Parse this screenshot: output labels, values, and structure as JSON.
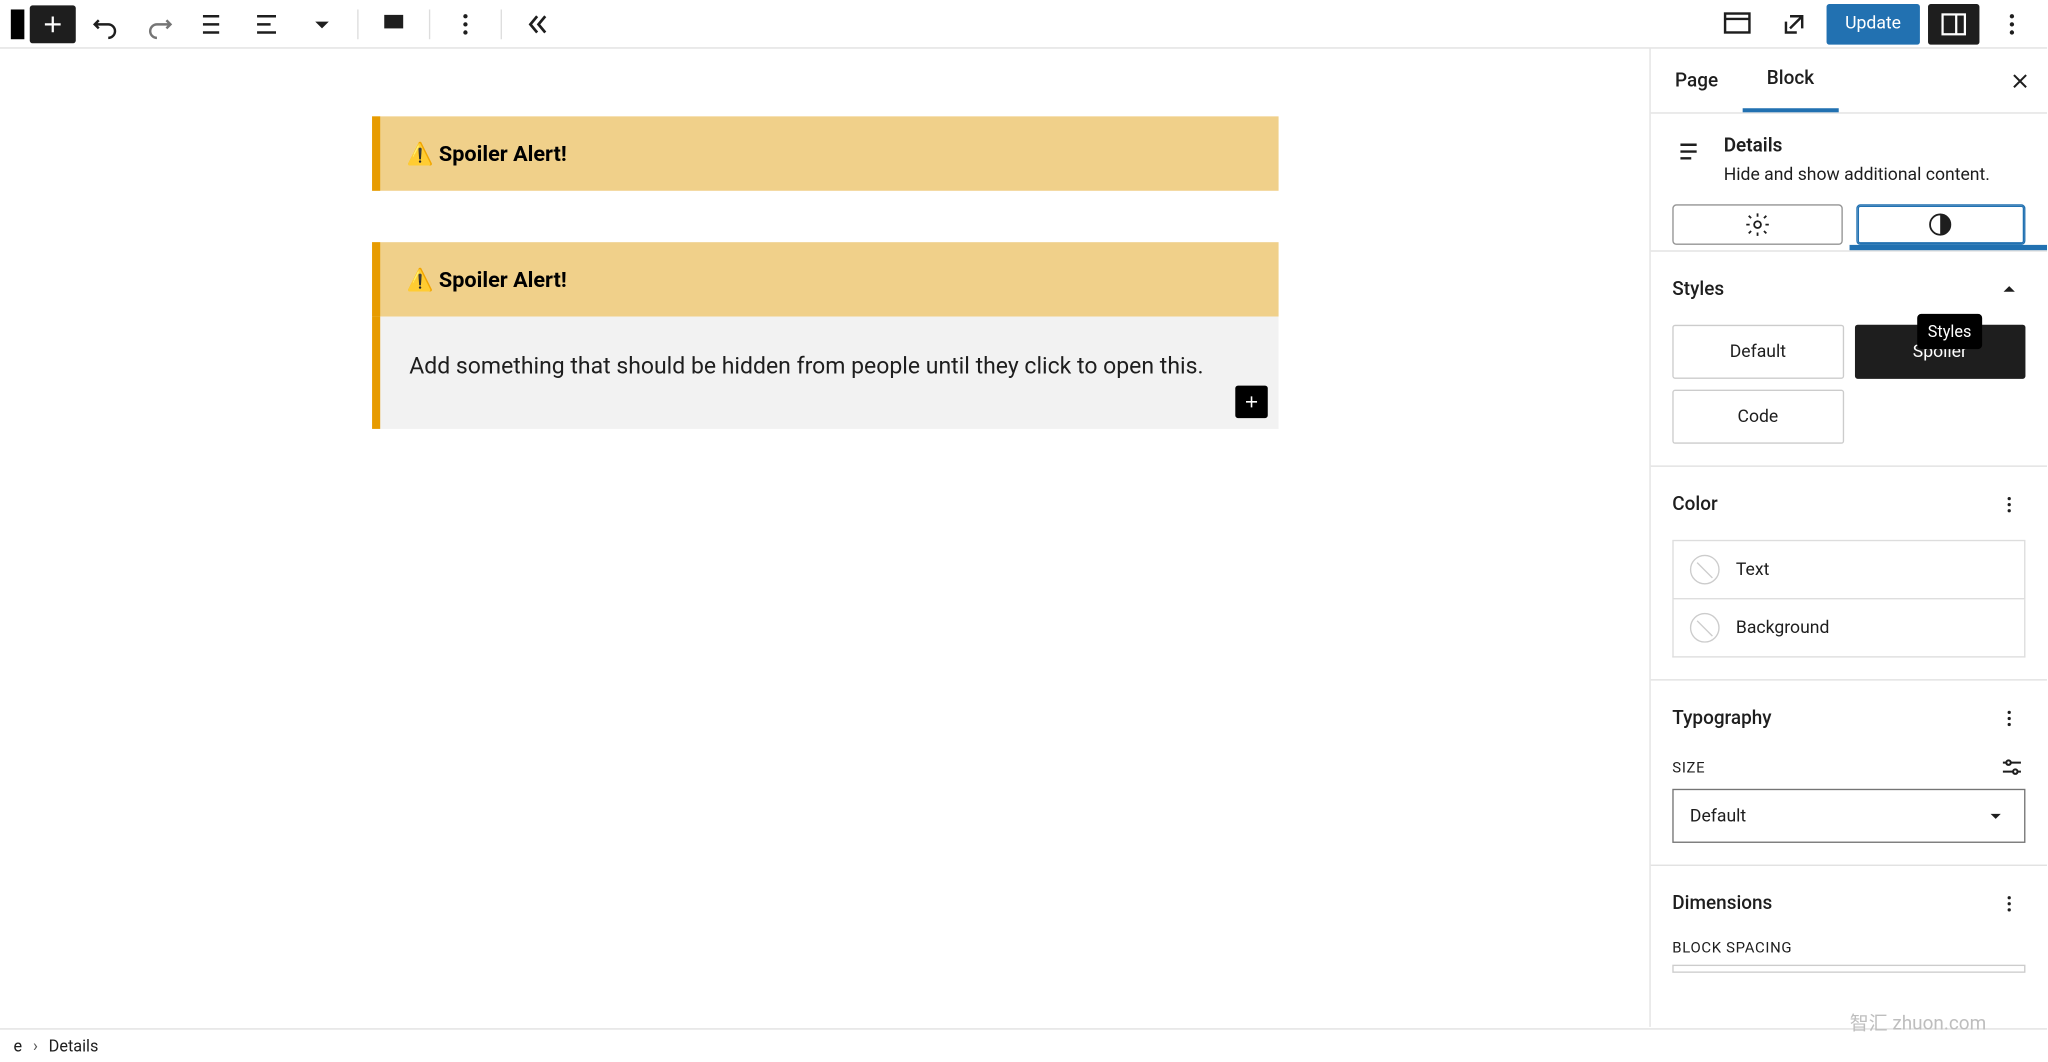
{
  "toolbar": {
    "update_label": "Update"
  },
  "editor": {
    "blocks": [
      {
        "summary": "⚠️ Spoiler Alert!"
      },
      {
        "summary": "⚠️ Spoiler Alert!",
        "content": "Add something that should be hidden from people until they click to open this."
      }
    ]
  },
  "sidebar": {
    "tabs": {
      "page": "Page",
      "block": "Block"
    },
    "block_info": {
      "title": "Details",
      "description": "Hide and show additional content."
    },
    "styles_tooltip": "Styles",
    "styles": {
      "title": "Styles",
      "options": {
        "default": "Default",
        "spoiler": "Spoiler",
        "code": "Code"
      }
    },
    "color": {
      "title": "Color",
      "text": "Text",
      "background": "Background"
    },
    "typography": {
      "title": "Typography",
      "size_label": "SIZE",
      "size_value": "Default"
    },
    "dimensions": {
      "title": "Dimensions",
      "spacing_label": "BLOCK SPACING"
    }
  },
  "breadcrumb": {
    "item1": "e",
    "item2": "Details"
  },
  "watermark": "智汇 zhuon.com"
}
